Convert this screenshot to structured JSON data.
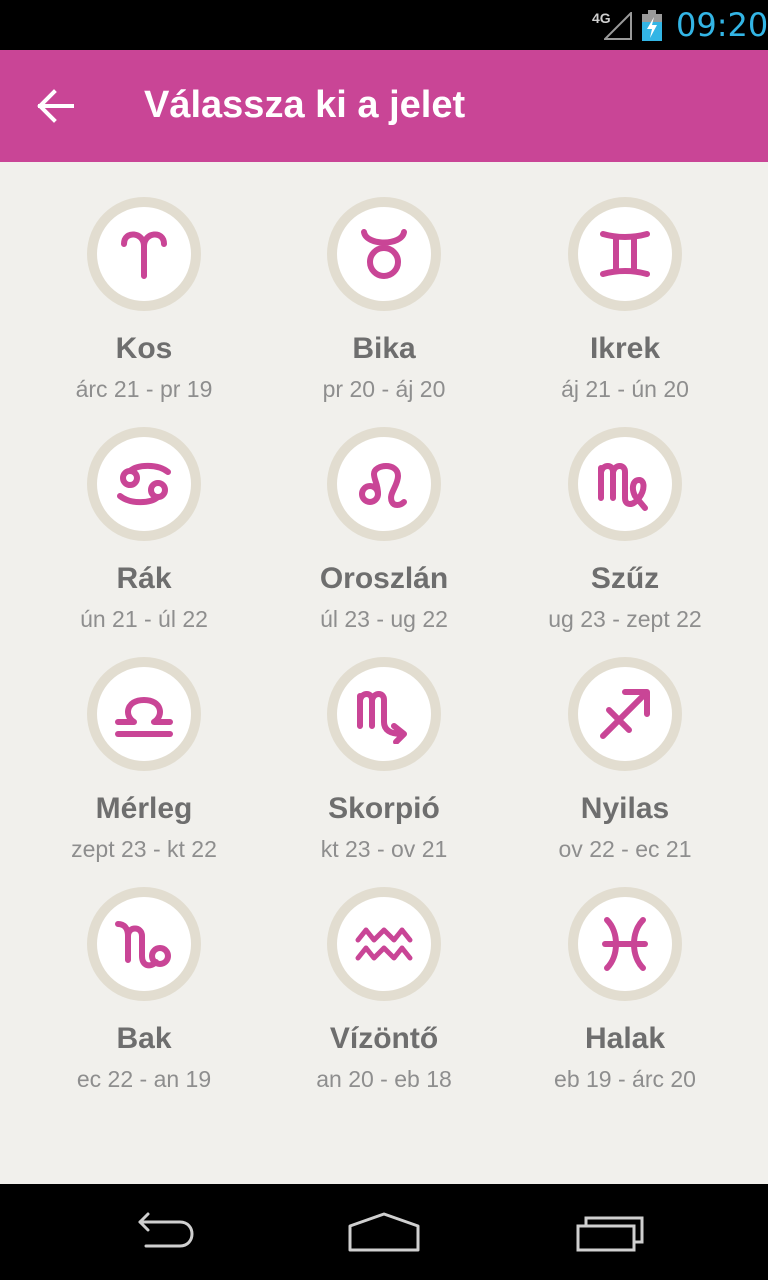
{
  "status_bar": {
    "network": "4G",
    "time": "09:20"
  },
  "action_bar": {
    "title": "Válassza ki a jelet",
    "back_icon": "arrow-left-icon"
  },
  "accent_color": "#c94596",
  "signs": [
    {
      "name": "Kos",
      "dates": "árc 21 - pr 19",
      "icon": "aries-icon"
    },
    {
      "name": "Bika",
      "dates": "pr 20 - áj 20",
      "icon": "taurus-icon"
    },
    {
      "name": "Ikrek",
      "dates": "áj 21 - ún 20",
      "icon": "gemini-icon"
    },
    {
      "name": "Rák",
      "dates": "ún 21 - úl 22",
      "icon": "cancer-icon"
    },
    {
      "name": "Oroszlán",
      "dates": "úl 23 - ug 22",
      "icon": "leo-icon"
    },
    {
      "name": "Szűz",
      "dates": "ug 23 - zept 22",
      "icon": "virgo-icon"
    },
    {
      "name": "Mérleg",
      "dates": "zept 23 - kt 22",
      "icon": "libra-icon"
    },
    {
      "name": "Skorpió",
      "dates": "kt 23 - ov 21",
      "icon": "scorpio-icon"
    },
    {
      "name": "Nyilas",
      "dates": "ov 22 - ec 21",
      "icon": "sagittarius-icon"
    },
    {
      "name": "Bak",
      "dates": "ec 22 - an 19",
      "icon": "capricorn-icon"
    },
    {
      "name": "Vízöntő",
      "dates": "an 20 - eb 18",
      "icon": "aquarius-icon"
    },
    {
      "name": "Halak",
      "dates": "eb 19 - árc 20",
      "icon": "pisces-icon"
    }
  ],
  "nav_bar": {
    "back_icon": "nav-back-icon",
    "home_icon": "nav-home-icon",
    "recents_icon": "nav-recents-icon"
  }
}
